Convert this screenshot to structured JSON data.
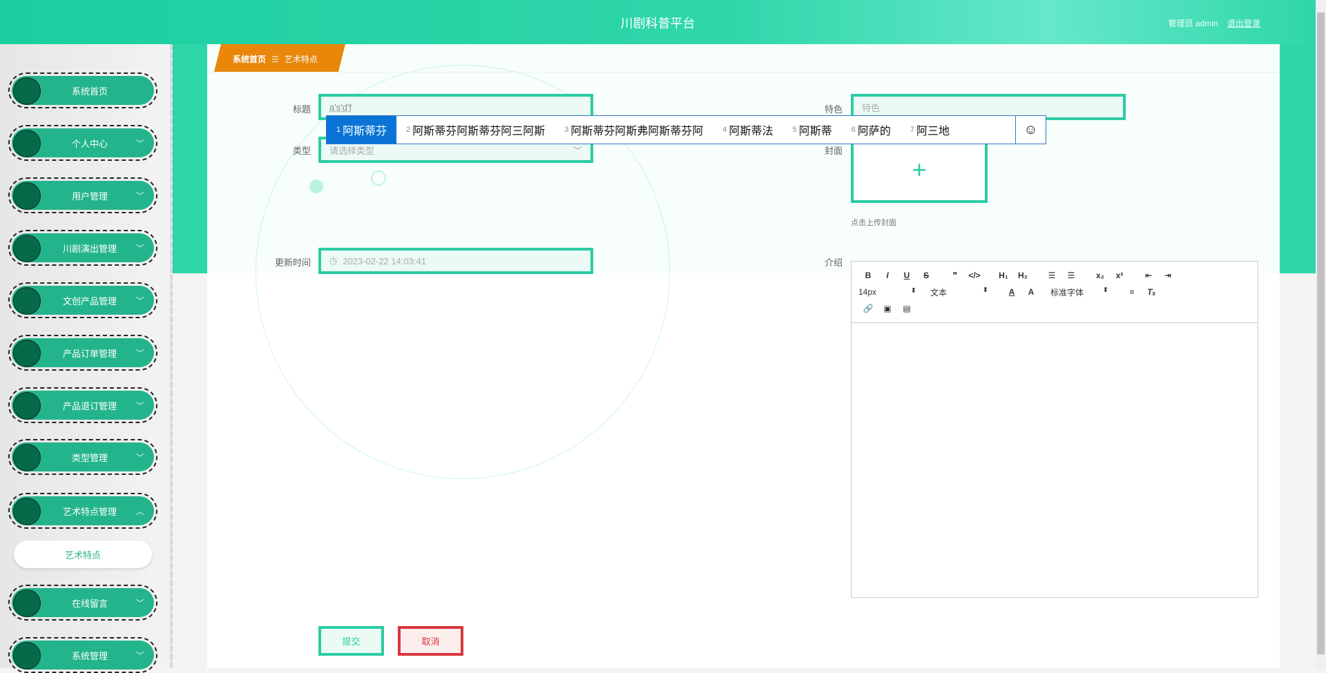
{
  "header": {
    "title": "川剧科普平台",
    "user_label": "管理员 admin",
    "logout": "退出登录"
  },
  "sidebar": {
    "items": [
      {
        "label": "系统首页",
        "chevron": ""
      },
      {
        "label": "个人中心",
        "chevron": "﹀"
      },
      {
        "label": "用户管理",
        "chevron": "﹀"
      },
      {
        "label": "川剧演出管理",
        "chevron": "﹀"
      },
      {
        "label": "文创产品管理",
        "chevron": "﹀"
      },
      {
        "label": "产品订单管理",
        "chevron": "﹀"
      },
      {
        "label": "产品退订管理",
        "chevron": "﹀"
      },
      {
        "label": "类型管理",
        "chevron": "﹀"
      },
      {
        "label": "艺术特点管理",
        "chevron": "︿"
      },
      {
        "label": "在线留言",
        "chevron": "﹀"
      },
      {
        "label": "系统管理",
        "chevron": "﹀"
      }
    ],
    "sub_item": "艺术特点"
  },
  "breadcrumb": {
    "home": "系统首页",
    "sep": "☰",
    "current": "艺术特点"
  },
  "form": {
    "title_label": "标题",
    "title_value": "a's'd'f",
    "type_label": "类型",
    "type_placeholder": "请选择类型",
    "time_label": "更新时间",
    "time_value": "2023-02-22 14:03:41",
    "feature_label": "特色",
    "feature_placeholder": "特色",
    "cover_label": "封面",
    "cover_hint": "点击上传封面",
    "intro_label": "介绍",
    "submit": "提交",
    "cancel": "取消"
  },
  "ime": {
    "candidates": [
      {
        "n": "1",
        "t": "阿斯蒂芬"
      },
      {
        "n": "2",
        "t": "阿斯蒂芬阿斯蒂芬阿三阿斯"
      },
      {
        "n": "3",
        "t": "阿斯蒂芬阿斯弗阿斯蒂芬阿"
      },
      {
        "n": "4",
        "t": "阿斯蒂法"
      },
      {
        "n": "5",
        "t": "阿斯蒂"
      },
      {
        "n": "6",
        "t": "阿萨的"
      },
      {
        "n": "7",
        "t": "阿三地"
      }
    ],
    "emoji": "☺"
  },
  "editor": {
    "size": "14px",
    "block": "文本",
    "font": "标准字体"
  }
}
